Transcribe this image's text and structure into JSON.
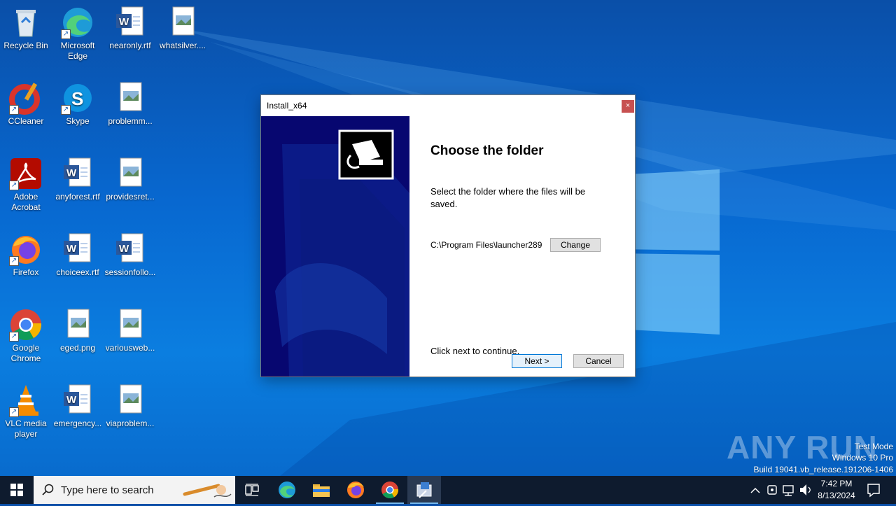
{
  "desktop_icons": [
    {
      "label": "Recycle Bin"
    },
    {
      "label": "Microsoft Edge"
    },
    {
      "label": "nearonly.rtf"
    },
    {
      "label": "whatsilver...."
    },
    {
      "label": "CCleaner"
    },
    {
      "label": "Skype"
    },
    {
      "label": "problemm..."
    },
    {
      "label": "Adobe Acrobat"
    },
    {
      "label": "anyforest.rtf"
    },
    {
      "label": "providesret..."
    },
    {
      "label": "Firefox"
    },
    {
      "label": "choiceex.rtf"
    },
    {
      "label": "sessionfollo..."
    },
    {
      "label": "Google Chrome"
    },
    {
      "label": "eged.png"
    },
    {
      "label": "variousweb..."
    },
    {
      "label": "VLC media player"
    },
    {
      "label": "emergency..."
    },
    {
      "label": "viaproblem..."
    }
  ],
  "dialog": {
    "title": "Install_x64",
    "close_label": "×",
    "heading": "Choose the folder",
    "description": "Select the folder where the files will be saved.",
    "path": "C:\\Program Files\\launcher289",
    "change_label": "Change",
    "continue_text": "Click next to continue.",
    "next_label": "Next >",
    "cancel_label": "Cancel"
  },
  "watermark": {
    "brand": "ANY RUN",
    "line1": "Test Mode",
    "line2": "Windows 10 Pro",
    "line3": "Build 19041.vb_release.191206-1406"
  },
  "taskbar": {
    "search_placeholder": "Type here to search",
    "time": "7:42 PM",
    "date": "8/13/2024"
  }
}
